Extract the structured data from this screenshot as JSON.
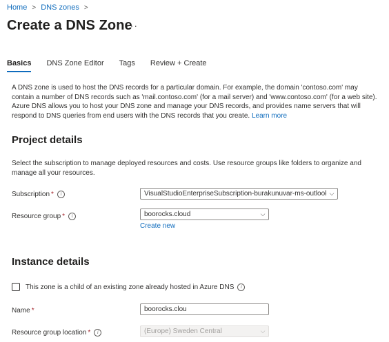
{
  "breadcrumb": {
    "home": "Home",
    "dns_zones": "DNS zones",
    "separator": ">"
  },
  "page": {
    "title": "Create a DNS Zone",
    "more": "···"
  },
  "tabs": [
    {
      "label": "Basics",
      "active": true
    },
    {
      "label": "DNS Zone Editor",
      "active": false
    },
    {
      "label": "Tags",
      "active": false
    },
    {
      "label": "Review + Create",
      "active": false
    }
  ],
  "intro": {
    "text": "A DNS zone is used to host the DNS records for a particular domain. For example, the domain 'contoso.com' may contain a number of DNS records such as 'mail.contoso.com' (for a mail server) and 'www.contoso.com' (for a web site). Azure DNS allows you to host your DNS zone and manage your DNS records, and provides name servers that will respond to DNS queries from end users with the DNS records that you create.",
    "learn_more": "Learn more"
  },
  "project": {
    "heading": "Project details",
    "description": "Select the subscription to manage deployed resources and costs. Use resource groups like folders to organize and manage all your resources.",
    "subscription_label": "Subscription",
    "subscription_value": "VisualStudioEnterpriseSubscription-burakunuvar-ms-outlook",
    "resource_group_label": "Resource group",
    "resource_group_value": "boorocks.cloud",
    "create_new": "Create new"
  },
  "instance": {
    "heading": "Instance details",
    "child_zone_label": "This zone is a child of an existing zone already hosted in Azure DNS",
    "child_zone_checked": false,
    "name_label": "Name",
    "name_value": "boorocks.clou",
    "location_label": "Resource group location",
    "location_value": "(Europe) Sweden Central"
  },
  "glyphs": {
    "required": "*",
    "info": "i",
    "chevron": "⌵"
  },
  "colors": {
    "accent": "#0f6cbd",
    "required": "#a4262c",
    "text": "#323130"
  }
}
